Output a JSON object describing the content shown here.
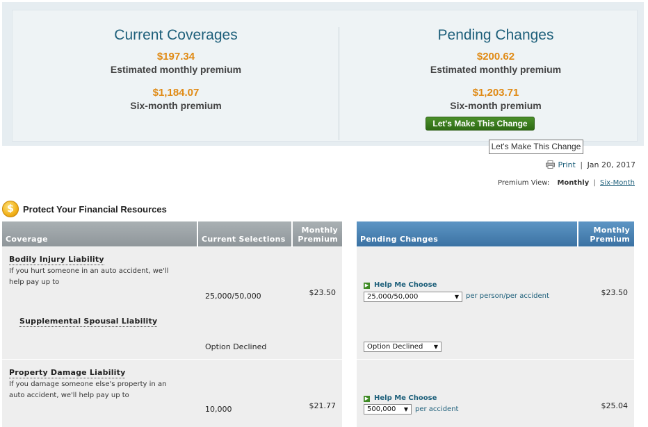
{
  "summary": {
    "current": {
      "title": "Current Coverages",
      "monthly_amount": "$197.34",
      "monthly_label": "Estimated monthly premium",
      "six_month_amount": "$1,184.07",
      "six_month_label": "Six-month premium"
    },
    "pending": {
      "title": "Pending Changes",
      "monthly_amount": "$200.62",
      "monthly_label": "Estimated monthly premium",
      "six_month_amount": "$1,203.71",
      "six_month_label": "Six-month premium",
      "button_label": "Let's Make This Change"
    },
    "tooltip": "Let's Make This Change"
  },
  "toolbar": {
    "print_label": "Print",
    "separator": "|",
    "date": "Jan 20, 2017",
    "premium_view_label": "Premium View:",
    "view_current": "Monthly",
    "view_separator": "|",
    "view_alt": "Six-Month"
  },
  "section": {
    "icon": "dollar-coin-icon",
    "icon_glyph": "$",
    "title": "Protect Your Financial Resources"
  },
  "table": {
    "headers": {
      "coverage": "Coverage",
      "current_selections": "Current Selections",
      "monthly_premium_l1": "Monthly",
      "monthly_premium_l2": "Premium",
      "pending_changes": "Pending Changes",
      "pending_monthly_l1": "Monthly",
      "pending_monthly_l2": "Premium"
    },
    "rows": [
      {
        "name": "Bodily Injury Liability",
        "desc_l1": "If you hurt someone in an auto accident, we'll",
        "desc_l2": "help pay up to",
        "current_value": "25,000/50,000",
        "current_premium": "$23.50",
        "help_label": "Help Me Choose",
        "selected": "25,000/50,000",
        "unit": "per person/per accident",
        "pending_premium": "$23.50"
      },
      {
        "name": "Supplemental Spousal Liability",
        "current_value": "Option Declined",
        "selected": "Option Declined"
      },
      {
        "name": "Property Damage Liability",
        "desc_l1": "If you damage someone else's property in an",
        "desc_l2": "auto accident, we'll help pay up to",
        "current_value": "10,000",
        "current_premium": "$21.77",
        "help_label": "Help Me Choose",
        "selected": "500,000",
        "unit": "per accident",
        "pending_premium": "$25.04"
      }
    ]
  },
  "colors": {
    "title_blue": "#1d5f7a",
    "amount_orange": "#e08a14",
    "button_green": "#3e7d1f",
    "header_gray": "#9aa1a5",
    "header_blue": "#4a82b3"
  }
}
